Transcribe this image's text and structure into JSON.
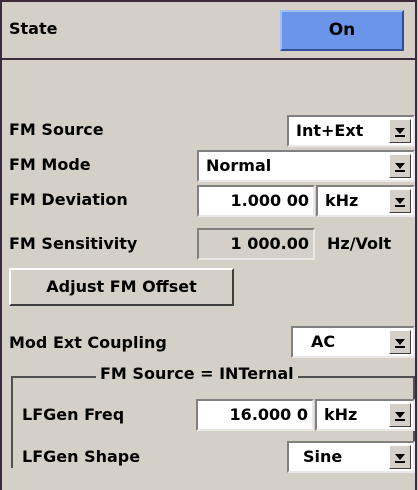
{
  "state": {
    "label": "State",
    "value": "On"
  },
  "fm_source": {
    "label": "FM Source",
    "value": "Int+Ext"
  },
  "fm_mode": {
    "label": "FM Mode",
    "value": "Normal"
  },
  "fm_deviation": {
    "label": "FM Deviation",
    "value": "1.000 00",
    "unit": "kHz"
  },
  "fm_sensitivity": {
    "label": "FM Sensitivity",
    "value": "1 000.00",
    "unit": "Hz/Volt"
  },
  "adjust_button": {
    "label": "Adjust FM Offset"
  },
  "mod_ext_coupling": {
    "label": "Mod Ext Coupling",
    "value": "AC"
  },
  "internal_group": {
    "title": "FM Source = INTernal",
    "lfgen_freq": {
      "label": "LFGen Freq",
      "value": "16.000 0",
      "unit": "kHz"
    },
    "lfgen_shape": {
      "label": "LFGen Shape",
      "value": "Sine"
    }
  },
  "colors": {
    "on_button": "#6b95e8",
    "panel_border": "#3b2a3e",
    "background": "#d4d0c8"
  }
}
